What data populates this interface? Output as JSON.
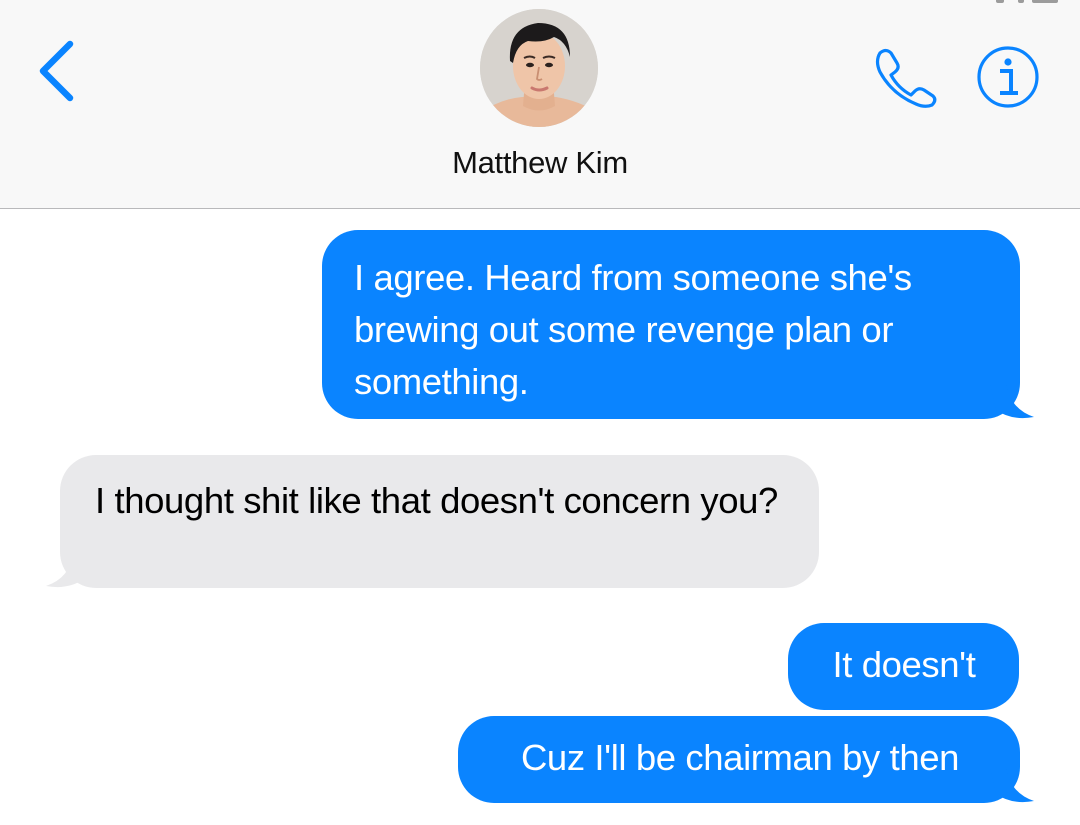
{
  "contact": {
    "name": "Matthew Kim"
  },
  "header": {
    "back_icon": "chevron-left-icon",
    "call_icon": "phone-icon",
    "info_icon": "info-circle-icon"
  },
  "messages": [
    {
      "direction": "sent",
      "text": "I agree. Heard from someone she's brewing out some revenge plan or something."
    },
    {
      "direction": "received",
      "text": "I thought shit like that doesn't concern you?"
    },
    {
      "direction": "sent",
      "text": "It doesn't"
    },
    {
      "direction": "sent",
      "text": "Cuz I'll be chairman by then"
    }
  ],
  "colors": {
    "accent_blue": "#0a84ff",
    "sent_bubble": "#0a84ff",
    "received_bubble": "#e9e9eb",
    "header_bg": "#f8f8f8"
  }
}
